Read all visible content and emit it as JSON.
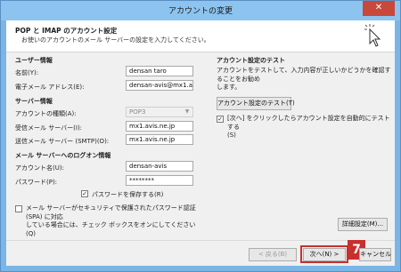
{
  "window": {
    "title": "アカウントの変更",
    "close_glyph": "✕"
  },
  "header": {
    "title": "POP と IMAP のアカウント設定",
    "subtitle": "お使いのアカウントのメール サーバーの設定を入力してください。"
  },
  "user_info": {
    "section": "ユーザー情報",
    "name_label": "名前(Y):",
    "name_value": "densan taro",
    "email_label": "電子メール アドレス(E):",
    "email_value": "densan-avis@mx1.avis.ne.jp"
  },
  "server_info": {
    "section": "サーバー情報",
    "account_type_label": "アカウントの種類(A):",
    "account_type_value": "POP3",
    "incoming_label": "受信メール サーバー(I):",
    "incoming_value": "mx1.avis.ne.jp",
    "outgoing_label": "送信メール サーバー (SMTP)(O):",
    "outgoing_value": "mx1.avis.ne.jp"
  },
  "logon_info": {
    "section": "メール サーバーへのログオン情報",
    "account_label": "アカウント名(U):",
    "account_value": "densan-avis",
    "password_label": "パスワード(P):",
    "password_value": "********",
    "save_password_label": "パスワードを保存する(R)",
    "save_password_checked": "✓",
    "spa_label_line1": "メール サーバーがセキュリティで保護されたパスワード認証 (SPA) に対応",
    "spa_label_line2": "している場合には、チェック ボックスをオンにしてください(Q)"
  },
  "test": {
    "section": "アカウント設定のテスト",
    "desc_line1": "アカウントをテストして、入力内容が正しいかどうかを確認することをお勧め",
    "desc_line2": "します。",
    "test_button": "アカウント設定のテスト(T)",
    "auto_test_checked": "✓",
    "auto_test_line1": "[次へ] をクリックしたらアカウント設定を自動的にテストする",
    "auto_test_line2": "(S)"
  },
  "buttons": {
    "details": "詳細設定(M)...",
    "back": "< 戻る(B)",
    "next": "次へ(N) >",
    "cancel": "キャンセル"
  },
  "annotation": {
    "step_number": "7"
  },
  "colors": {
    "titlebar": "#8cc3ef",
    "highlight": "#c6302d"
  }
}
